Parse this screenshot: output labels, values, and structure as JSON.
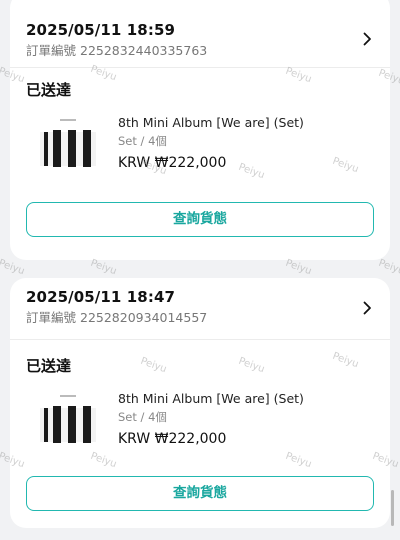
{
  "orders": [
    {
      "datetime": "2025/05/11 18:59",
      "order_label": "訂單編號",
      "order_number": "2252832440335763",
      "status": "已送達",
      "item": {
        "title": "8th Mini Album [We are] (Set)",
        "meta": "Set / 4個",
        "price": "KRW ₩222,000"
      },
      "track_label": "查詢貨態"
    },
    {
      "datetime": "2025/05/11 18:47",
      "order_label": "訂單編號",
      "order_number": "2252820934014557",
      "status": "已送達",
      "item": {
        "title": "8th Mini Album [We are] (Set)",
        "meta": "Set / 4個",
        "price": "KRW ₩222,000"
      },
      "track_label": "查詢貨態"
    }
  ],
  "watermark": "Peiyu",
  "colors": {
    "accent": "#22b8b0",
    "background": "#f1f2f4"
  }
}
